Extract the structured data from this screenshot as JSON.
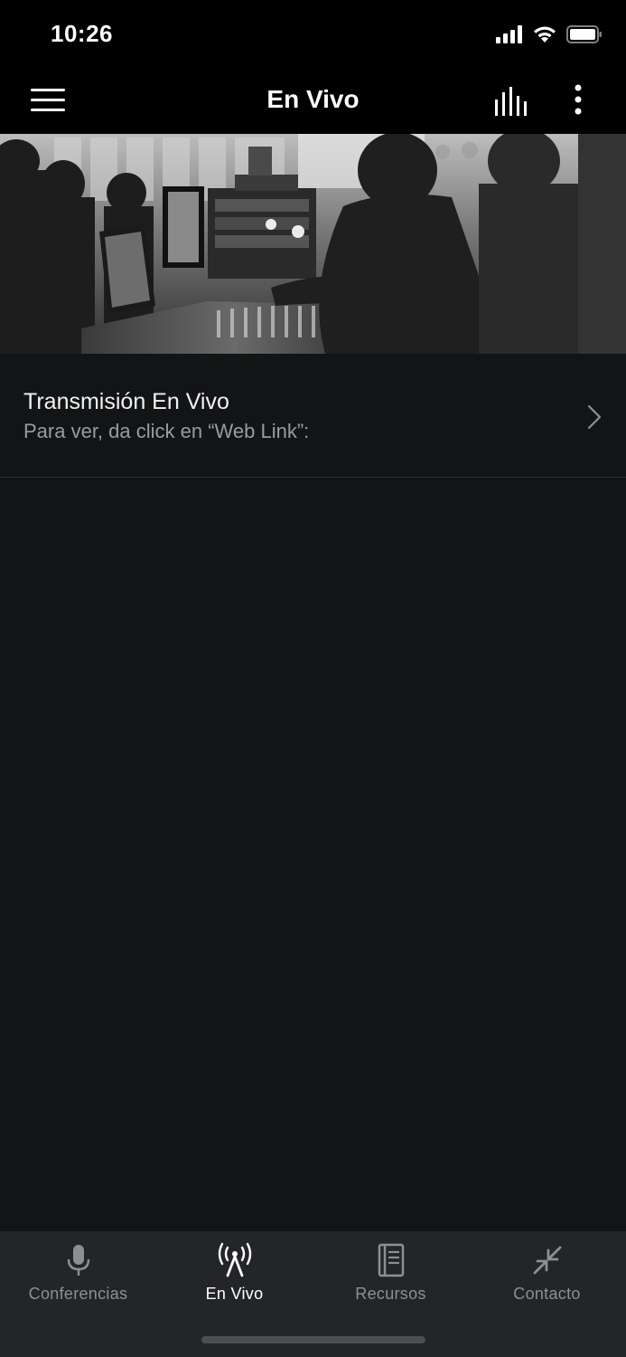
{
  "status_bar": {
    "time": "10:26"
  },
  "nav": {
    "title": "En Vivo",
    "menu_icon": "hamburger-menu-icon",
    "equalizer_icon": "equalizer-icon",
    "more_icon": "more-vertical-icon"
  },
  "hero": {
    "image": "photo of live sound mixing console with audience"
  },
  "live_item": {
    "title": "Transmisión En Vivo",
    "subtitle": "Para ver, da click en “Web Link”:"
  },
  "tabs": [
    {
      "label": "Conferencias",
      "icon": "microphone-icon",
      "active": false
    },
    {
      "label": "En Vivo",
      "icon": "broadcast-antenna-icon",
      "active": true
    },
    {
      "label": "Recursos",
      "icon": "book-icon",
      "active": false
    },
    {
      "label": "Contacto",
      "icon": "compress-arrows-icon",
      "active": false
    }
  ],
  "colors": {
    "background": "#131416",
    "header": "#000000",
    "tabbar": "#242528",
    "active_tab": "#ffffff",
    "inactive_tab": "#8e8f94"
  }
}
